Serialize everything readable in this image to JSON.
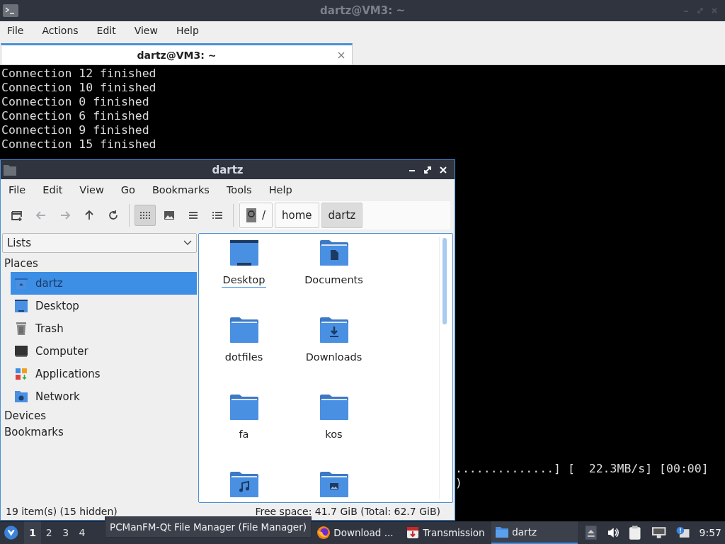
{
  "terminal": {
    "title": "dartz@VM3: ~",
    "menu": [
      "File",
      "Actions",
      "Edit",
      "View",
      "Help"
    ],
    "tabs": [
      {
        "label": "dartz@VM3: ~",
        "selected": true
      }
    ],
    "lines": [
      "Connection 12 finished",
      "Connection 10 finished",
      "Connection 0 finished",
      "Connection 6 finished",
      "Connection 9 finished",
      "Connection 15 finished"
    ],
    "right_lines": [
      "..............] [  22.3MB/s] [00:00]",
      ")"
    ]
  },
  "file_manager": {
    "title": "dartz",
    "menu": [
      "File",
      "Edit",
      "View",
      "Go",
      "Bookmarks",
      "Tools",
      "Help"
    ],
    "nav_buttons": [
      {
        "kind": "new-tab",
        "disabled": false
      },
      {
        "kind": "back",
        "disabled": true
      },
      {
        "kind": "forward",
        "disabled": true
      },
      {
        "kind": "up",
        "disabled": false
      },
      {
        "kind": "reload",
        "disabled": false
      }
    ],
    "view_modes": [
      {
        "kind": "icons",
        "selected": true
      },
      {
        "kind": "thumbnails",
        "selected": false
      },
      {
        "kind": "compact",
        "selected": false
      },
      {
        "kind": "detailed",
        "selected": false
      }
    ],
    "path": [
      {
        "label": "/",
        "kind": "root",
        "selected": false
      },
      {
        "label": "home",
        "kind": "dir",
        "selected": false
      },
      {
        "label": "dartz",
        "kind": "dir",
        "selected": true
      }
    ],
    "sidebar": {
      "dropdown": "Lists",
      "sections": [
        {
          "label": "Places",
          "items": [
            {
              "label": "dartz",
              "kind": "home",
              "selected": true
            },
            {
              "label": "Desktop",
              "kind": "desktop",
              "selected": false
            },
            {
              "label": "Trash",
              "kind": "trash",
              "selected": false
            },
            {
              "label": "Computer",
              "kind": "computer",
              "selected": false
            },
            {
              "label": "Applications",
              "kind": "apps",
              "selected": false
            },
            {
              "label": "Network",
              "kind": "network",
              "selected": false
            }
          ]
        },
        {
          "label": "Devices"
        },
        {
          "label": "Bookmarks"
        }
      ]
    },
    "files": [
      {
        "name": "Desktop",
        "kind": "desktop",
        "focused": true
      },
      {
        "name": "Documents",
        "kind": "documents",
        "focused": false
      },
      {
        "name": "dotfiles",
        "kind": "folder",
        "focused": false
      },
      {
        "name": "Downloads",
        "kind": "downloads",
        "focused": false
      },
      {
        "name": "fa",
        "kind": "folder",
        "focused": false
      },
      {
        "name": "kos",
        "kind": "folder",
        "focused": false
      },
      {
        "kind": "music"
      },
      {
        "kind": "pictures"
      }
    ],
    "status_left": "19 item(s) (15 hidden)",
    "status_right": "Free space: 41.7 GiB (Total: 62.7 GiB)"
  },
  "taskbar": {
    "workspaces": [
      {
        "label": "1",
        "selected": true
      },
      {
        "label": "2",
        "selected": false
      },
      {
        "label": "3",
        "selected": false
      },
      {
        "label": "4",
        "selected": false
      }
    ],
    "tooltip": "PCManFM-Qt File Manager (File Manager)",
    "tasks": [
      {
        "label": "Download ...",
        "kind": "browser",
        "selected": false
      },
      {
        "label": "Transmission",
        "kind": "torrent",
        "selected": false
      },
      {
        "label": "dartz",
        "kind": "folder",
        "selected": true
      }
    ],
    "clock": "9:57"
  }
}
